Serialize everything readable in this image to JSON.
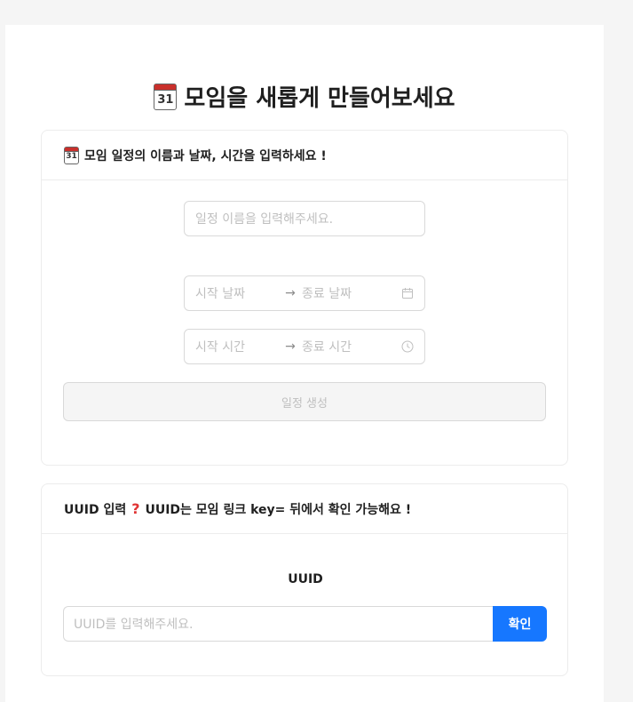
{
  "page": {
    "title": "모임을 새롭게 만들어보세요",
    "calendar_day": "31"
  },
  "schedule_card": {
    "header": "모임 일정의 이름과 날짜, 시간을 입력하세요 !",
    "name_input": {
      "placeholder": "일정 이름을 입력해주세요.",
      "value": ""
    },
    "date_range": {
      "start_placeholder": "시작 날짜",
      "separator": "→",
      "end_placeholder": "종료 날짜"
    },
    "time_range": {
      "start_placeholder": "시작 시간",
      "separator": "→",
      "end_placeholder": "종료 시간"
    },
    "create_button": "일정 생성"
  },
  "uuid_card": {
    "header_prefix": "UUID 입력",
    "header_suffix": "UUID는 모임 링크 key= 뒤에서 확인 가능해요 !",
    "label": "UUID",
    "input": {
      "placeholder": "UUID를 입력해주세요.",
      "value": ""
    },
    "confirm_button": "확인"
  },
  "colors": {
    "primary": "#1677ff",
    "background": "#f5f5f5",
    "border": "#d9d9d9",
    "placeholder": "#bfbfbf",
    "question_mark": "#e03434"
  },
  "icons": [
    "calendar-icon",
    "question-icon",
    "calendar-suffix-icon",
    "clock-icon",
    "arrow-right-icon"
  ]
}
